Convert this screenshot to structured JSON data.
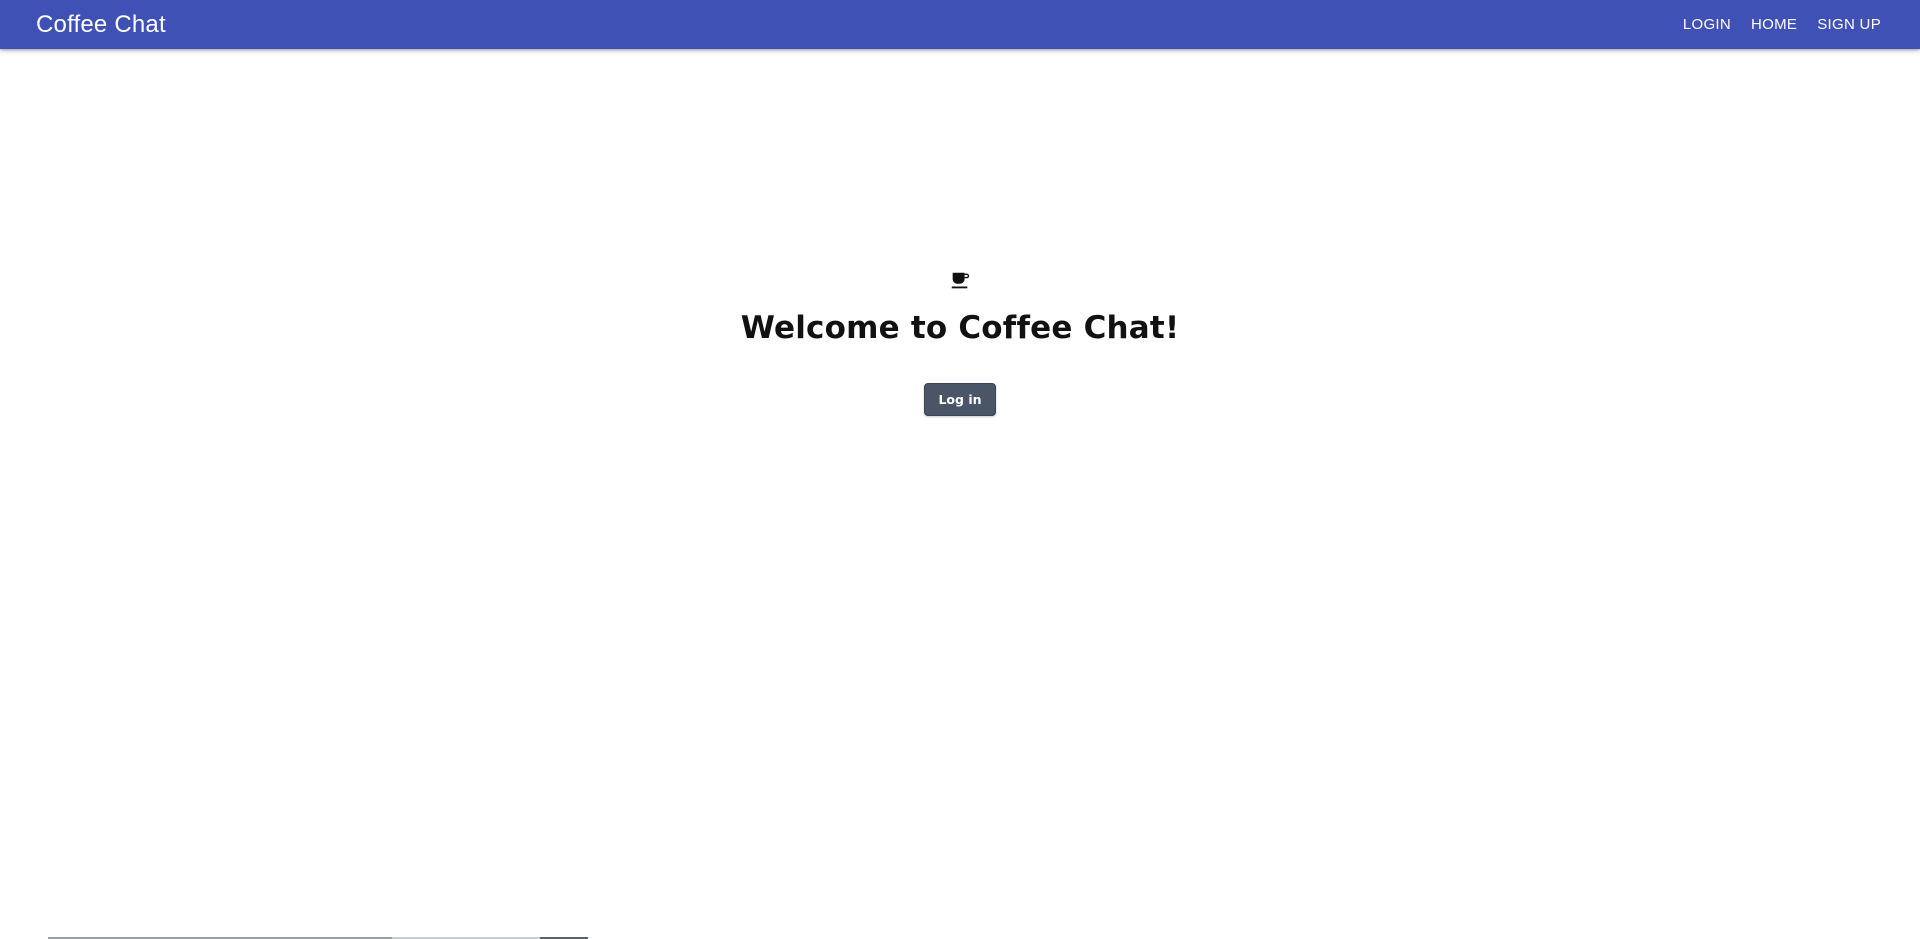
{
  "appbar": {
    "brand": "Coffee Chat",
    "background_color": "#3f51b5",
    "nav": [
      {
        "label": "LOGIN"
      },
      {
        "label": "HOME"
      },
      {
        "label": "SIGN UP"
      }
    ]
  },
  "hero": {
    "icon": "coffee-cup-icon",
    "title": "Welcome to Coffee Chat!",
    "login_button_label": "Log in",
    "button_color": "#4a5568"
  }
}
